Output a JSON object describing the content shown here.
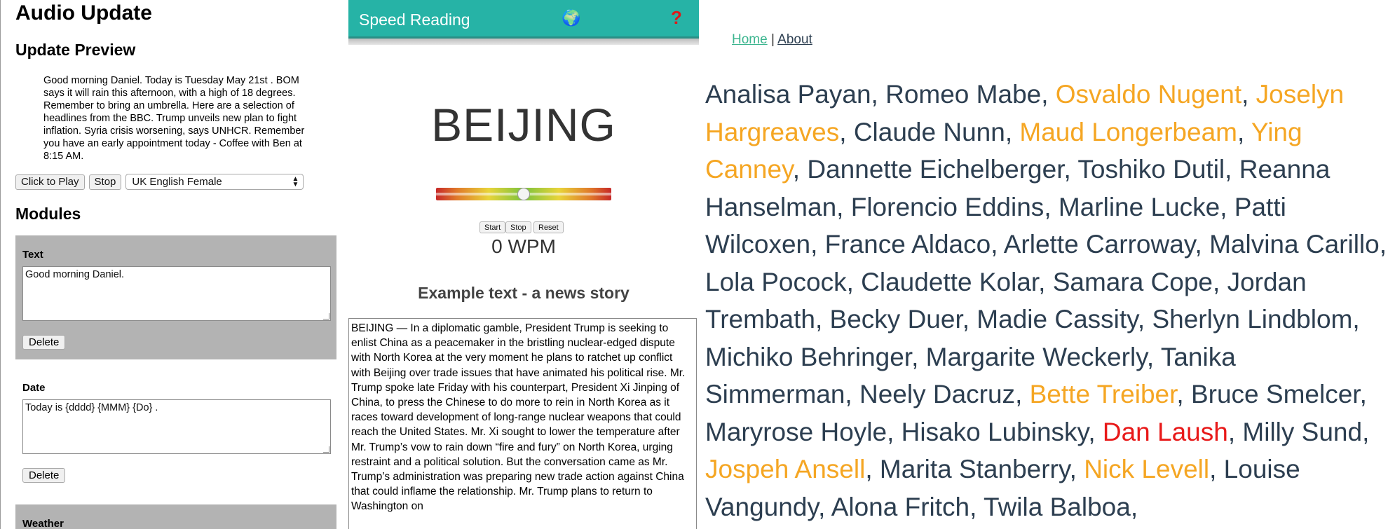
{
  "audio": {
    "title": "Audio Update",
    "preview_heading": "Update Preview",
    "preview_text": "Good morning Daniel. Today is Tuesday May 21st . BOM says it will rain this afternoon, with a high of 18 degrees. Remember to bring an umbrella. Here are a selection of headlines from the BBC. Trump unveils new plan to fight inflation. Syria crisis worsening, says UNHCR. Remember you have an early appointment today - Coffee with Ben at 8:15 AM.",
    "play_label": "Click to Play",
    "stop_label": "Stop",
    "voice_selected": "UK English Female",
    "modules_heading": "Modules",
    "modules": [
      {
        "label": "Text",
        "value": "Good morning Daniel.",
        "delete_label": "Delete"
      },
      {
        "label": "Date",
        "value": "Today is {dddd} {MMM} {Do} .",
        "delete_label": "Delete"
      },
      {
        "label": "Weather"
      }
    ]
  },
  "speed": {
    "app_title": "Speed Reading",
    "globe_icon": "🌍",
    "help_icon": "?",
    "current_word": "BEIJING",
    "speed_level": 0.5,
    "start_label": "Start",
    "stop_label": "Stop",
    "reset_label": "Reset",
    "wpm_text": "0 WPM",
    "example_title": "Example text - a news story",
    "story": "BEIJING — In a diplomatic gamble, President Trump is seeking to enlist China as a peacemaker in the bristling nuclear-edged dispute with North Korea at the very moment he plans to ratchet up conflict with Beijing over trade issues that have animated his political rise. Mr. Trump spoke late Friday with his counterpart, President Xi Jinping of China, to press the Chinese to do more to rein in North Korea as it races toward development of long-range nuclear weapons that could reach the United States. Mr. Xi sought to lower the temperature after Mr. Trump’s vow to rain down “fire and fury” on North Korea, urging restraint and a political solution. But the conversation came as Mr. Trump’s administration was preparing new trade action against China that could inflame the relationship. Mr. Trump plans to return to Washington on"
  },
  "names": {
    "nav_home": "Home",
    "nav_sep": "|",
    "nav_about": "About",
    "colors": {
      "default": "#2c3e50",
      "orange": "#f5a623",
      "red": "#e81919"
    },
    "people": [
      {
        "name": "Analisa Payan",
        "status": "default"
      },
      {
        "name": "Romeo Mabe",
        "status": "default"
      },
      {
        "name": "Osvaldo Nugent",
        "status": "orange"
      },
      {
        "name": "Joselyn Hargreaves",
        "status": "orange"
      },
      {
        "name": "Claude Nunn",
        "status": "default"
      },
      {
        "name": "Maud Longerbeam",
        "status": "orange"
      },
      {
        "name": "Ying Canney",
        "status": "orange"
      },
      {
        "name": "Dannette Eichelberger",
        "status": "default"
      },
      {
        "name": "Toshiko Dutil",
        "status": "default"
      },
      {
        "name": "Reanna Hanselman",
        "status": "default"
      },
      {
        "name": "Florencio Eddins",
        "status": "default"
      },
      {
        "name": "Marline Lucke",
        "status": "default"
      },
      {
        "name": "Patti Wilcoxen",
        "status": "default"
      },
      {
        "name": "France Aldaco",
        "status": "default"
      },
      {
        "name": "Arlette Carroway",
        "status": "default"
      },
      {
        "name": "Malvina Carillo",
        "status": "default"
      },
      {
        "name": "Lola Pocock",
        "status": "default"
      },
      {
        "name": "Claudette Kolar",
        "status": "default"
      },
      {
        "name": "Samara Cope",
        "status": "default"
      },
      {
        "name": "Jordan Trembath",
        "status": "default"
      },
      {
        "name": "Becky Duer",
        "status": "default"
      },
      {
        "name": "Madie Cassity",
        "status": "default"
      },
      {
        "name": "Sherlyn Lindblom",
        "status": "default"
      },
      {
        "name": "Michiko Behringer",
        "status": "default"
      },
      {
        "name": "Margarite Weckerly",
        "status": "default"
      },
      {
        "name": "Tanika Simmerman",
        "status": "default"
      },
      {
        "name": "Neely Dacruz",
        "status": "default"
      },
      {
        "name": "Bette Treiber",
        "status": "orange"
      },
      {
        "name": "Bruce Smelcer",
        "status": "default"
      },
      {
        "name": "Maryrose Hoyle",
        "status": "default"
      },
      {
        "name": "Hisako Lubinsky",
        "status": "default"
      },
      {
        "name": "Dan Laush",
        "status": "red"
      },
      {
        "name": "Milly Sund",
        "status": "default"
      },
      {
        "name": "Jospeh Ansell",
        "status": "orange"
      },
      {
        "name": "Marita Stanberry",
        "status": "default"
      },
      {
        "name": "Nick Levell",
        "status": "orange"
      },
      {
        "name": "Louise Vangundy",
        "status": "default"
      },
      {
        "name": "Alona Fritch",
        "status": "default"
      },
      {
        "name": "Twila Balboa",
        "status": "default"
      }
    ]
  }
}
